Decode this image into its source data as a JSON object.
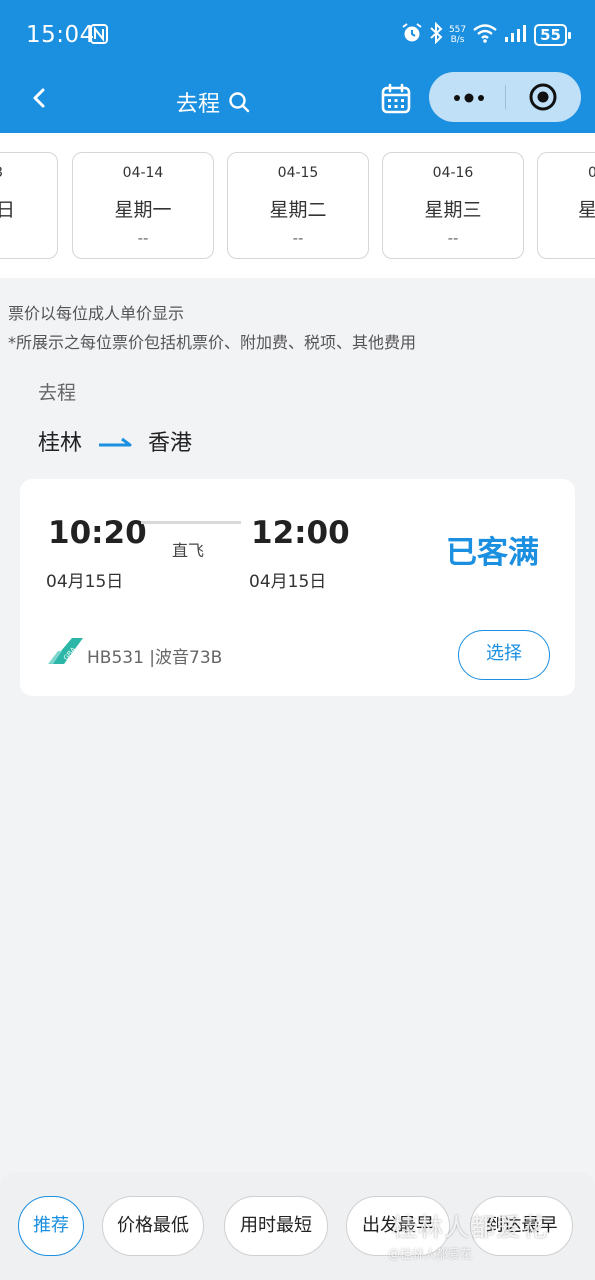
{
  "status_bar": {
    "time": "15:04",
    "net_speed_value": "557",
    "net_speed_unit": "B/s",
    "battery": "55"
  },
  "nav": {
    "title": "去程"
  },
  "dates": [
    {
      "date": "3",
      "weekday": "日",
      "price": ""
    },
    {
      "date": "04-14",
      "weekday": "星期一",
      "price": "--"
    },
    {
      "date": "04-15",
      "weekday": "星期二",
      "price": "--"
    },
    {
      "date": "04-16",
      "weekday": "星期三",
      "price": "--"
    },
    {
      "date": "0",
      "weekday": "星",
      "price": ""
    }
  ],
  "notes": {
    "line1": "票价以每位成人单价显示",
    "line2": "*所展示之每位票价包括机票价、附加费、税项、其他费用"
  },
  "section_label": "去程",
  "route": {
    "from": "桂林",
    "to": "香港"
  },
  "flight": {
    "dep_time": "10:20",
    "dep_date": "04月15日",
    "arr_time": "12:00",
    "arr_date": "04月15日",
    "type": "直飞",
    "status": "已客满",
    "flight_info": "HB531 |波音73B",
    "select_label": "选择",
    "airline_logo_text": "GBA"
  },
  "sort_options": [
    "推荐",
    "价格最低",
    "用时最短",
    "出发最早",
    "到达最早"
  ],
  "watermark": "桂林人都爱花",
  "watermark_sub": "@桂林人都爱花",
  "colors": {
    "primary": "#1b8fe0",
    "background": "#f2f3f5",
    "airline_teal": "#2bb6a8"
  }
}
